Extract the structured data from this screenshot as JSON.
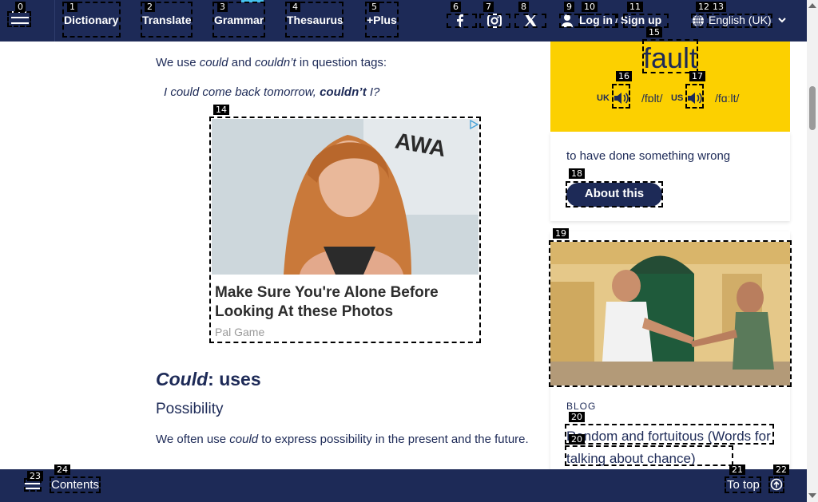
{
  "nav": {
    "links": [
      "Dictionary",
      "Translate",
      "Grammar",
      "Thesaurus",
      "+Plus"
    ],
    "login": "Log in",
    "slash": "/",
    "signup": "Sign up",
    "language": "English (UK)"
  },
  "badges": [
    "0",
    "1",
    "2",
    "3",
    "4",
    "5",
    "6",
    "7",
    "8",
    "9",
    "10",
    "11",
    "12",
    "13",
    "14",
    "15",
    "16",
    "17",
    "18",
    "19",
    "20",
    "20",
    "21",
    "22",
    "23",
    "24"
  ],
  "main": {
    "p1_pre": "We use ",
    "p1_could": "could",
    "p1_and": " and ",
    "p1_couldnt": "couldn’t",
    "p1_post": " in question tags:",
    "example_pre": "I could come back tomorrow, ",
    "example_bold": "couldn’t",
    "example_post": " I?",
    "h2_italic": "Could",
    "h2_rest": ": uses",
    "h3": "Possibility",
    "p2_pre": "We often use ",
    "p2_could": "could",
    "p2_post": " to express possibility in the present and the future."
  },
  "ad": {
    "title": "Make Sure You're Alone Before Looking At these Photos",
    "source": "Pal Game",
    "backdrop_text": "AWA"
  },
  "wotd": {
    "word": "fault",
    "uk_label": "UK",
    "uk_pron": "/fɒlt/",
    "us_label": "US",
    "us_pron": "/fɑːlt/",
    "definition": "to have done something wrong",
    "about_button": "About this"
  },
  "blog": {
    "label": "BLOG",
    "title": "Random and fortuitous (Words for talking about chance)"
  },
  "bottom": {
    "contents": "Contents",
    "to_top": "To top"
  },
  "colors": {
    "navy": "#1d2a57",
    "yellow": "#fcd000",
    "accent": "#45c1ec"
  }
}
